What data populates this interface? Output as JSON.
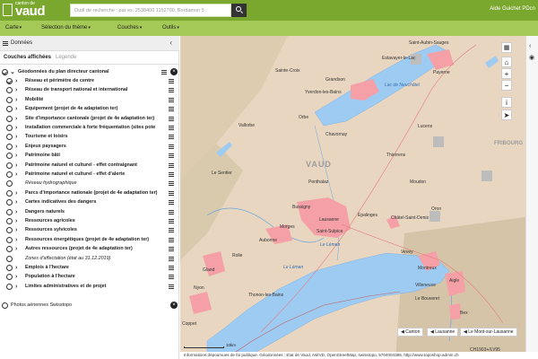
{
  "header": {
    "logo_small": "canton de",
    "logo_big": "vaud",
    "search_placeholder": "Outil de recherche : par ex. 2538400 1152700, Bordamon 5",
    "right_links": "Aide Guichet PDcn"
  },
  "menubar": {
    "items": [
      {
        "label": "Carte"
      },
      {
        "label": "Sélection du thème"
      },
      {
        "label": "Couches"
      },
      {
        "label": "Outils"
      }
    ]
  },
  "panel": {
    "title": "Données",
    "tabs": [
      {
        "label": "Couches affichées",
        "active": true
      },
      {
        "label": "Légende",
        "active": false
      }
    ],
    "group_label": "Géodonnées du plan directeur cantonal",
    "layers": [
      {
        "label": "Réseau et périmètre de centre",
        "style": "bold",
        "checked": true
      },
      {
        "label": "Réseau de transport national et international",
        "style": "bold",
        "checked": false
      },
      {
        "label": "Mobilité",
        "style": "bold",
        "checked": false
      },
      {
        "label": "Equipement (projet de 4e adaptation ter)",
        "style": "bold",
        "checked": false
      },
      {
        "label": "Site d'importance cantonale (projet de 4e adaptation ter)",
        "style": "bold",
        "checked": false
      },
      {
        "label": "Installation commerciale à forte fréquentation (sites pote",
        "style": "bold",
        "checked": false
      },
      {
        "label": "Tourisme et loisirs",
        "style": "bold",
        "checked": false
      },
      {
        "label": "Enjeux paysagers",
        "style": "bold",
        "checked": false
      },
      {
        "label": "Patrimoine bâti",
        "style": "bold",
        "checked": false
      },
      {
        "label": "Patrimoine naturel et culturel - effet contraignant",
        "style": "bold",
        "checked": false
      },
      {
        "label": "Patrimoine naturel et culturel - effet d'alerte",
        "style": "bold",
        "checked": false
      },
      {
        "label": "Réseau hydrographique",
        "style": "italic",
        "checked": false
      },
      {
        "label": "Parcs d'importance nationale (projet de 4e adaptation ter)",
        "style": "bold",
        "checked": false
      },
      {
        "label": "Cartes indicatives des dangers",
        "style": "bold",
        "checked": false
      },
      {
        "label": "Dangers naturels",
        "style": "bold",
        "checked": false
      },
      {
        "label": "Ressources agricoles",
        "style": "bold",
        "checked": false
      },
      {
        "label": "Ressources sylvicoles",
        "style": "bold",
        "checked": false
      },
      {
        "label": "Ressources énergétiques (projet de 4e adaptation ter)",
        "style": "bold",
        "checked": false
      },
      {
        "label": "Autres ressources (projet de 4e adaptation ter)",
        "style": "bold",
        "checked": false
      },
      {
        "label": "Zones d'affectation (état au 31.12.2019)",
        "style": "italic",
        "checked": false
      },
      {
        "label": "Emplois à l'hectare",
        "style": "bold",
        "checked": false
      },
      {
        "label": "Population à l'hectare",
        "style": "bold",
        "checked": false
      },
      {
        "label": "Limites administratives et de projet",
        "style": "bold",
        "checked": false
      }
    ],
    "base_layer": "Photos aériennes Swisstopo"
  },
  "map": {
    "labels": [
      {
        "text": "Sainte-Croix"
      },
      {
        "text": "Grandson"
      },
      {
        "text": "Yverdon-les-Bains"
      },
      {
        "text": "Estavayer-le-Lac"
      },
      {
        "text": "Saint-Aubin-Sauges"
      },
      {
        "text": "Payerne"
      },
      {
        "text": "Vallorbe"
      },
      {
        "text": "Orbe"
      },
      {
        "text": "Chavornay"
      },
      {
        "text": "Lucens"
      },
      {
        "text": "VAUD"
      },
      {
        "text": "FRIBOURG"
      },
      {
        "text": "Le Sentier"
      },
      {
        "text": "Penthalaz"
      },
      {
        "text": "Thierrens"
      },
      {
        "text": "Moudon"
      },
      {
        "text": "Oron"
      },
      {
        "text": "Bussigny"
      },
      {
        "text": "Lausanne"
      },
      {
        "text": "Epalinges"
      },
      {
        "text": "Châtel-Saint-Denis"
      },
      {
        "text": "Morges"
      },
      {
        "text": "Saint-Sulpice"
      },
      {
        "text": "Le Léman"
      },
      {
        "text": "Aubonne"
      },
      {
        "text": "Rolle"
      },
      {
        "text": "Vevey"
      },
      {
        "text": "Gland"
      },
      {
        "text": "Nyon"
      },
      {
        "text": "Montreux"
      },
      {
        "text": "Villeneuve"
      },
      {
        "text": "Thonon-les-Bains"
      },
      {
        "text": "Coppet"
      },
      {
        "text": "Aigle"
      },
      {
        "text": "Le Bouveret"
      },
      {
        "text": "Bex"
      }
    ],
    "water_labels": [
      "Lac de Neuchâtel",
      "Le Léman"
    ],
    "bottom_chips": [
      "Canton",
      "Lausanne",
      "Le Mont-sur-Lausanne"
    ],
    "coord_system": "CH1903+/LV95",
    "scale_label": "10km",
    "attribution": "Informations dépourvues de foi publique. Géodonnées : Etat de Vaud, AsitVD, OpenStreetMap, swisstopo, 5704004385, http://www.toposhop.admin.ch",
    "colors": {
      "urban": "#f4a0a6",
      "water": "#9ecbf2",
      "terrain": "#ead7c4",
      "menubar": "#a5c957",
      "header": "#7aa82e"
    }
  }
}
